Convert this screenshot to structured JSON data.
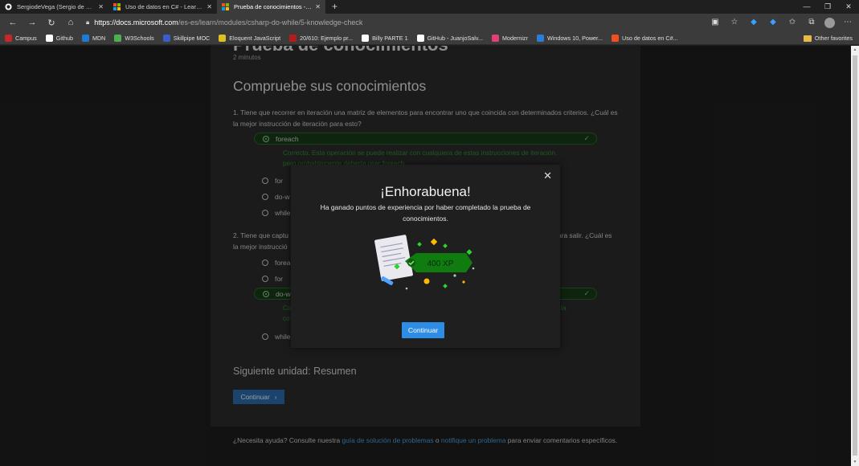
{
  "browser": {
    "tabs": [
      {
        "title": "SergiodeVega (Sergio de Vega A",
        "active": false,
        "icon": "github-icon"
      },
      {
        "title": "Uso de datos en C# - Learn | Mic",
        "active": false,
        "icon": "microsoft-icon"
      },
      {
        "title": "Prueba de conocimientos - Lear",
        "active": true,
        "icon": "microsoft-icon"
      }
    ],
    "url_host": "https://docs.microsoft.com",
    "url_path": "/es-es/learn/modules/csharp-do-while/5-knowledge-check",
    "bookmarks": [
      {
        "label": "Campus",
        "color": "#c62828"
      },
      {
        "label": "Github",
        "color": "#ffffff"
      },
      {
        "label": "MDN",
        "color": "#1f7ad6"
      },
      {
        "label": "W3Schools",
        "color": "#4caf50"
      },
      {
        "label": "Skillpipe MOC",
        "color": "#3a5ec7"
      },
      {
        "label": "Eloquent JavaScript",
        "color": "#e0c020"
      },
      {
        "label": "20/610: Ejemplo pr...",
        "color": "#b71c1c"
      },
      {
        "label": "Billy PARTE 1",
        "color": "#ffffff"
      },
      {
        "label": "GitHub - JuanjoSalv...",
        "color": "#ffffff"
      },
      {
        "label": "Modernizr",
        "color": "#e0407a"
      },
      {
        "label": "Windows 10, Power...",
        "color": "#2a7fd4"
      },
      {
        "label": "Uso de datos en C#...",
        "color": "#f25022"
      }
    ],
    "other_favorites": "Other favorites"
  },
  "page": {
    "title": "Prueba de conocimientos",
    "minutes": "2 minutos",
    "heading": "Compruebe sus conocimientos",
    "q1": "1. Tiene que recorrer en iteración una matriz de elementos para encontrar uno que coincida con determinados criterios. ¿Cuál es la mejor instrucción de iteración para esto?",
    "q1_options": [
      "foreach",
      "for",
      "do-w",
      "while"
    ],
    "q1_feedback_line1": "Correcto. Esta operación se puede realizar con cualquiera de estas instrucciones de iteración,",
    "q1_feedback_line2": "pero probablemente debería usar foreach.",
    "q2_line1": "2. Tiene que captu",
    "q2_line1_end": "ara salir. ¿Cuál es",
    "q2_line2": "la mejor instrucció",
    "q2_options": [
      "forea",
      "for",
      "do-w",
      "while"
    ],
    "q2_feedback_a": "Co",
    "q2_feedback_a_end": "la",
    "q2_feedback_b": "co",
    "next_heading": "Siguiente unidad: Resumen",
    "next_button": "Continuar",
    "footer_pre": "¿Necesita ayuda? Consulte nuestra ",
    "footer_link1": "guía de solución de problemas",
    "footer_mid": " o ",
    "footer_link2": "notifique un problema",
    "footer_post": " para enviar comentarios específicos."
  },
  "modal": {
    "title": "¡Enhorabuena!",
    "text": "Ha ganado puntos de experiencia por haber completado la prueba de conocimientos.",
    "xp": "400 XP",
    "button": "Continuar"
  }
}
